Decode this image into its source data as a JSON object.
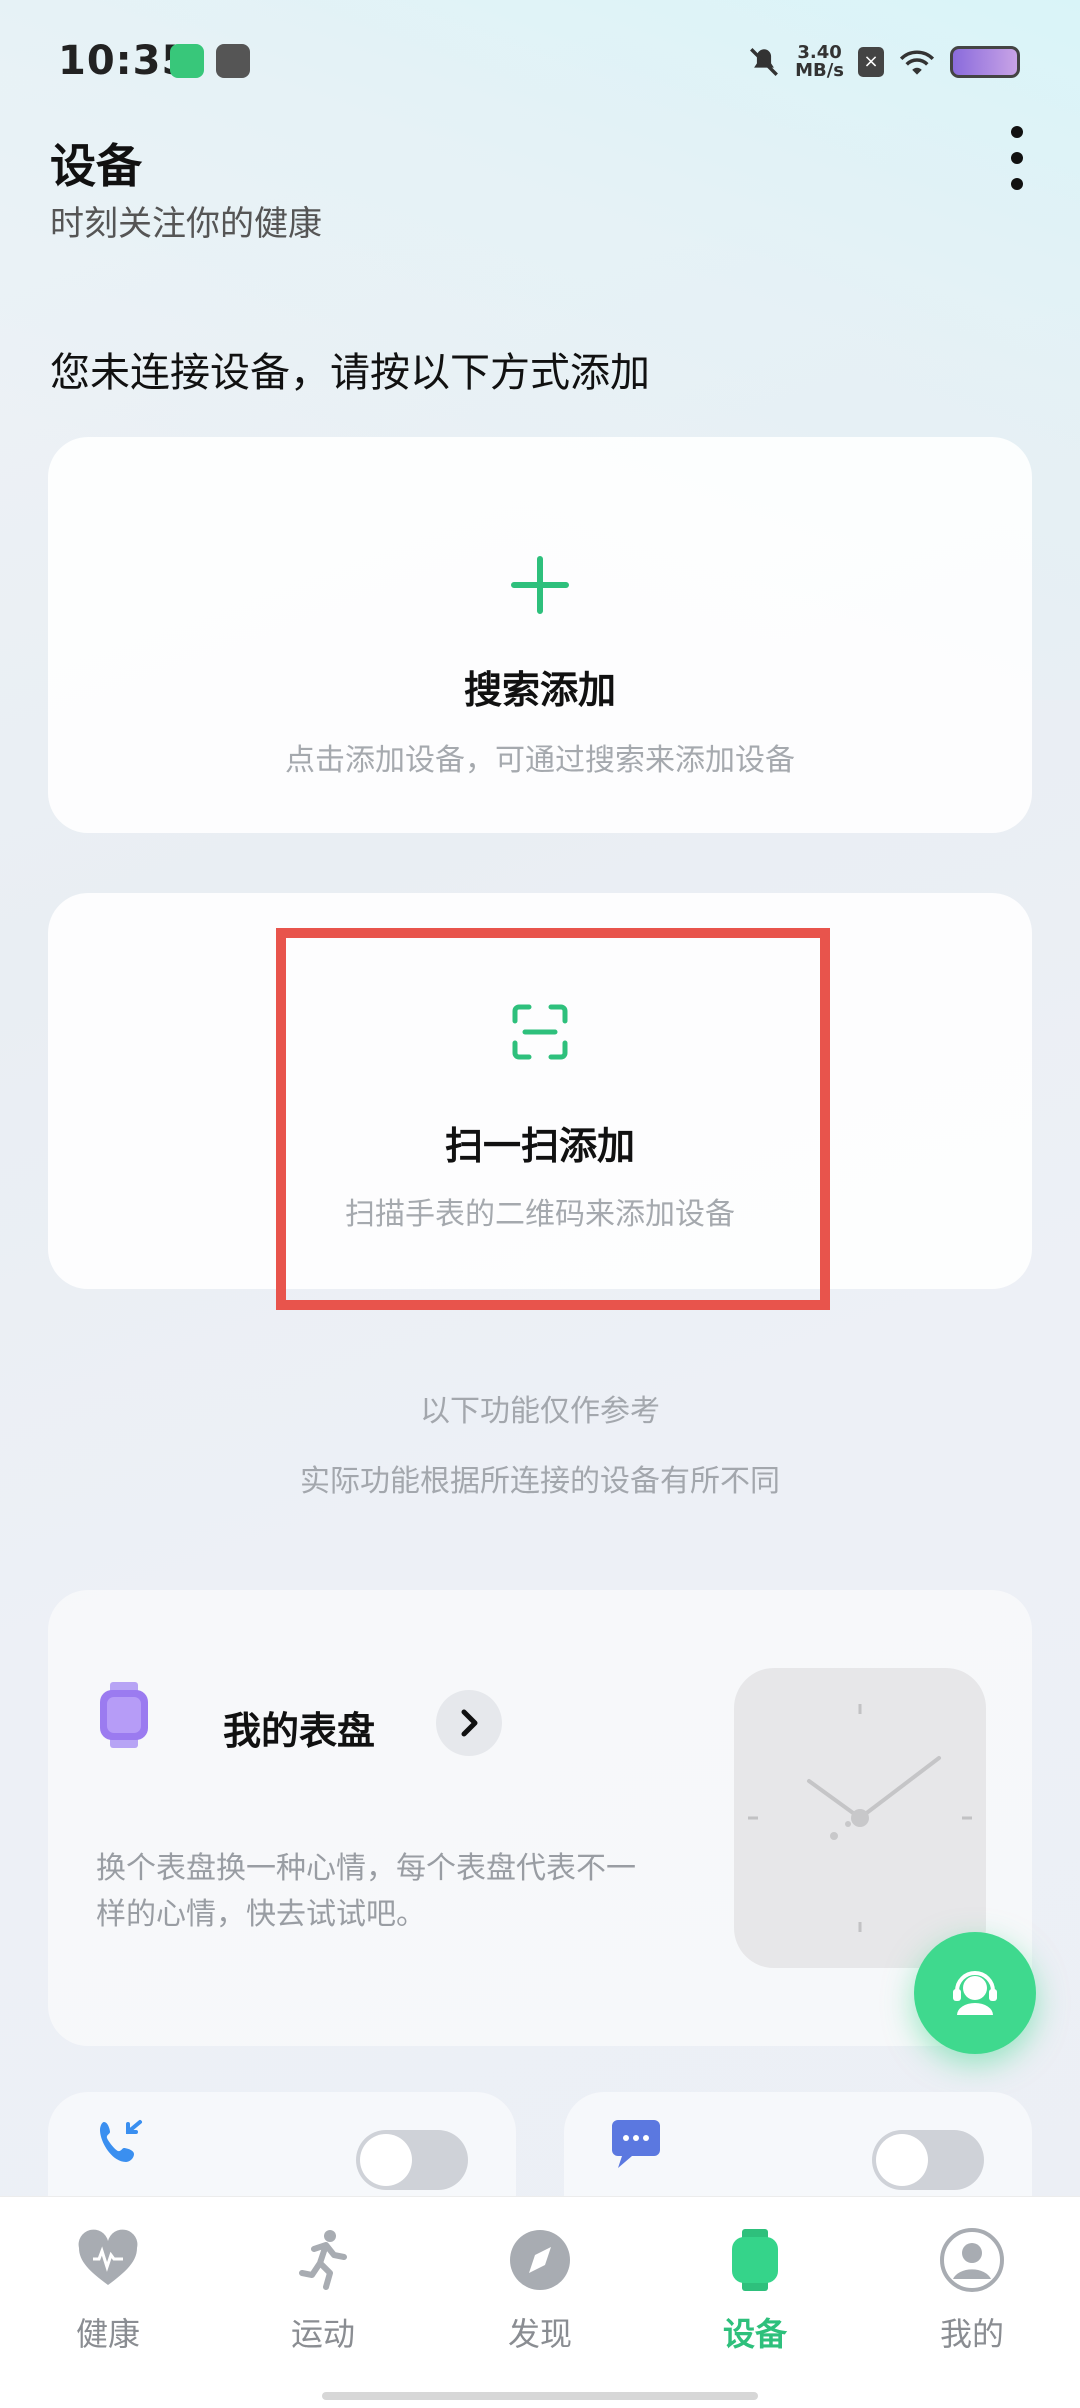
{
  "status_bar": {
    "time": "10:35",
    "speed_value": "3.40",
    "speed_unit": "MB/s"
  },
  "header": {
    "title": "设备",
    "subtitle": "时刻关注你的健康"
  },
  "prompt": "您未连接设备，请按以下方式添加",
  "search_card": {
    "icon": "plus-icon",
    "title": "搜索添加",
    "desc": "点击添加设备，可通过搜索来添加设备"
  },
  "scan_card": {
    "icon": "scan-icon",
    "title": "扫一扫添加",
    "desc": "扫描手表的二维码来添加设备"
  },
  "notes": {
    "line1": "以下功能仅作参考",
    "line2": "实际功能根据所连接的设备有所不同"
  },
  "watch_face_card": {
    "title": "我的表盘",
    "desc": "换个表盘换一种心情，每个表盘代表不一样的心情，快去试试吧。"
  },
  "toggles": [
    {
      "icon": "call-icon",
      "on": false
    },
    {
      "icon": "message-icon",
      "on": false
    }
  ],
  "nav": [
    {
      "label": "健康",
      "icon": "heart-icon",
      "active": false
    },
    {
      "label": "运动",
      "icon": "running-icon",
      "active": false
    },
    {
      "label": "发现",
      "icon": "compass-icon",
      "active": false
    },
    {
      "label": "设备",
      "icon": "watch-icon",
      "active": true
    },
    {
      "label": "我的",
      "icon": "profile-icon",
      "active": false
    }
  ],
  "colors": {
    "accent": "#2ec07c",
    "highlight": "#e8544c",
    "watch_icon": "#9b7bf0",
    "call_icon": "#3a8ff0",
    "message_icon": "#5b78e0"
  }
}
